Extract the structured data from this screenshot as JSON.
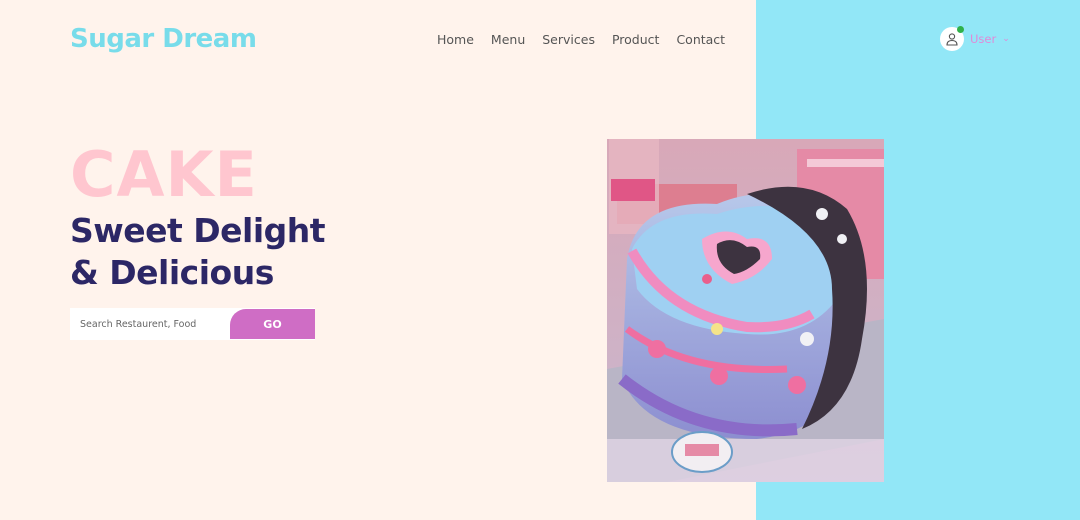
{
  "brand": {
    "name": "Sugar Dream"
  },
  "nav": {
    "items": [
      "Home",
      "Menu",
      "Services",
      "Product",
      "Contact"
    ]
  },
  "user": {
    "label": "User",
    "status_color": "#2fb14a"
  },
  "hero": {
    "headline": "CAKE",
    "subline_1": "Sweet Delight",
    "subline_2": "& Delicious"
  },
  "search": {
    "placeholder": "Search Restaurent, Food",
    "button_label": "GO"
  },
  "colors": {
    "accent": "#cf6dc5",
    "brand": "#78dcea",
    "heading": "#2c2766",
    "headline": "#ffc6cf",
    "panel": "#92e7f7",
    "background": "#fff3ec"
  },
  "image": {
    "alt": "heart-shaped pastel cake"
  }
}
